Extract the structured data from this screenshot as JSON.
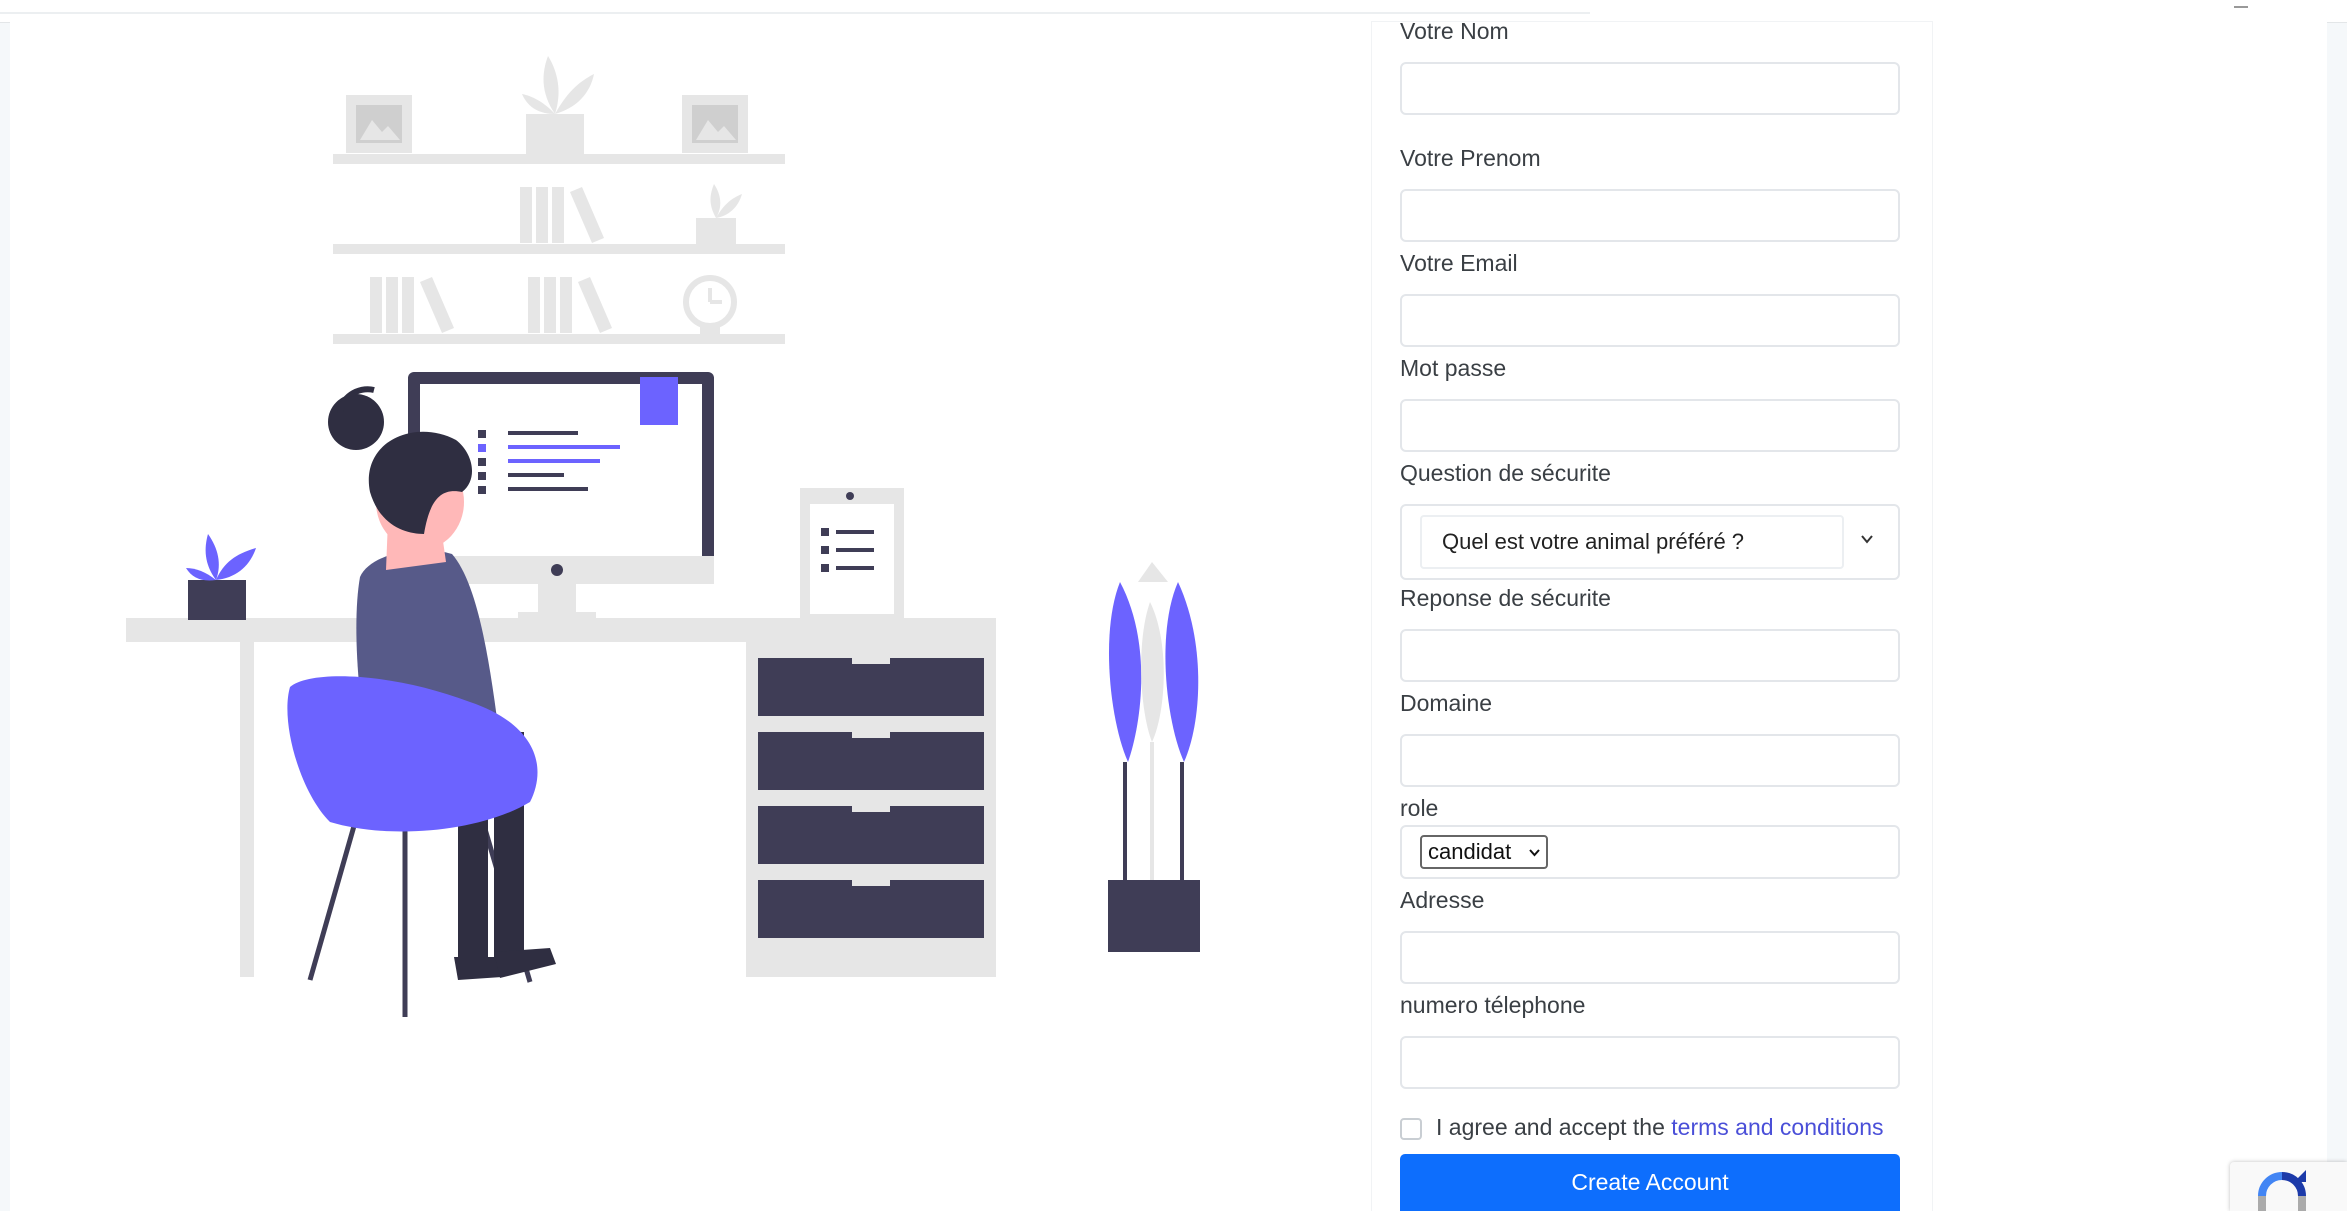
{
  "form": {
    "fields": {
      "nom": {
        "label": "Votre Nom",
        "value": ""
      },
      "prenom": {
        "label": "Votre Prenom",
        "value": ""
      },
      "email": {
        "label": "Votre Email",
        "value": ""
      },
      "password": {
        "label": "Mot passe",
        "value": ""
      },
      "question": {
        "label": "Question de sécurite",
        "selected": "Quel est votre animal préféré ?"
      },
      "reponse": {
        "label": "Reponse de sécurite",
        "value": ""
      },
      "domaine": {
        "label": "Domaine",
        "value": ""
      },
      "role": {
        "label": "role",
        "selected": "candidat"
      },
      "adresse": {
        "label": "Adresse",
        "value": ""
      },
      "telephone": {
        "label": "numero télephone",
        "value": ""
      }
    },
    "agree_prefix": "I agree and accept the",
    "terms_link": "terms and conditions",
    "create_button": "Create Account"
  },
  "icons": {
    "select_chevron": "chevron-down-icon",
    "recaptcha": "recaptcha-icon"
  },
  "colors": {
    "accent": "#6c63ff",
    "dark": "#3f3d56",
    "button": "#0d6efd",
    "link": "#4a4fd8"
  }
}
